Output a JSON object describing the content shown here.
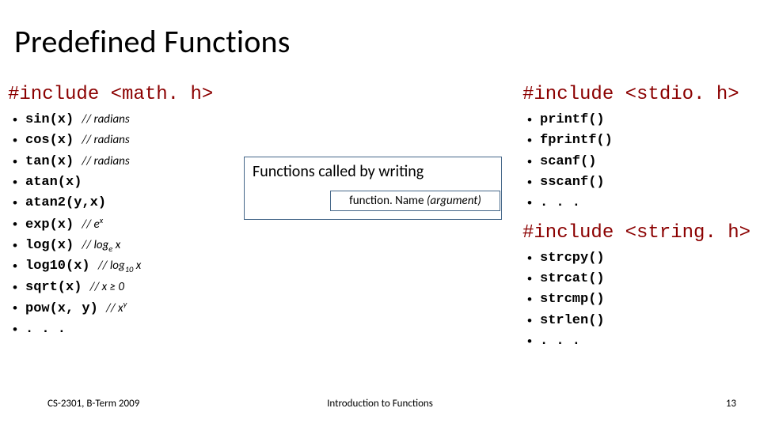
{
  "title": "Predefined Functions",
  "left": {
    "header": "#include <math. h>",
    "items": [
      {
        "code": "sin(x)",
        "comment": "// radians"
      },
      {
        "code": "cos(x)",
        "comment": "// radians"
      },
      {
        "code": "tan(x)",
        "comment": "// radians"
      },
      {
        "code": "atan(x)",
        "comment": ""
      },
      {
        "code": "atan2(y,x)",
        "comment": ""
      },
      {
        "code": "exp(x)",
        "comment_html": "// e^x"
      },
      {
        "code": "log(x)",
        "comment_html": "// log_e x"
      },
      {
        "code": "log10(x)",
        "comment_html": "// log_10 x"
      },
      {
        "code": "sqrt(x)",
        "comment_html": "// x ≥ 0"
      },
      {
        "code": "pow(x, y)",
        "comment_html": "// x^y"
      },
      {
        "code": ". . .",
        "comment": ""
      }
    ]
  },
  "right": [
    {
      "header": "#include <stdio. h>",
      "items": [
        "printf()",
        "fprintf()",
        "scanf()",
        "sscanf()",
        ". . ."
      ]
    },
    {
      "header": "#include <string. h>",
      "items": [
        "strcpy()",
        "strcat()",
        "strcmp()",
        "strlen()",
        ". . ."
      ]
    }
  ],
  "box": {
    "line1": "Functions called by writing",
    "sub_fn": "function. Name",
    "sub_arg": "(argument)"
  },
  "footer": {
    "left": "CS-2301, B-Term 2009",
    "center": "Introduction to Functions",
    "right": "13"
  }
}
